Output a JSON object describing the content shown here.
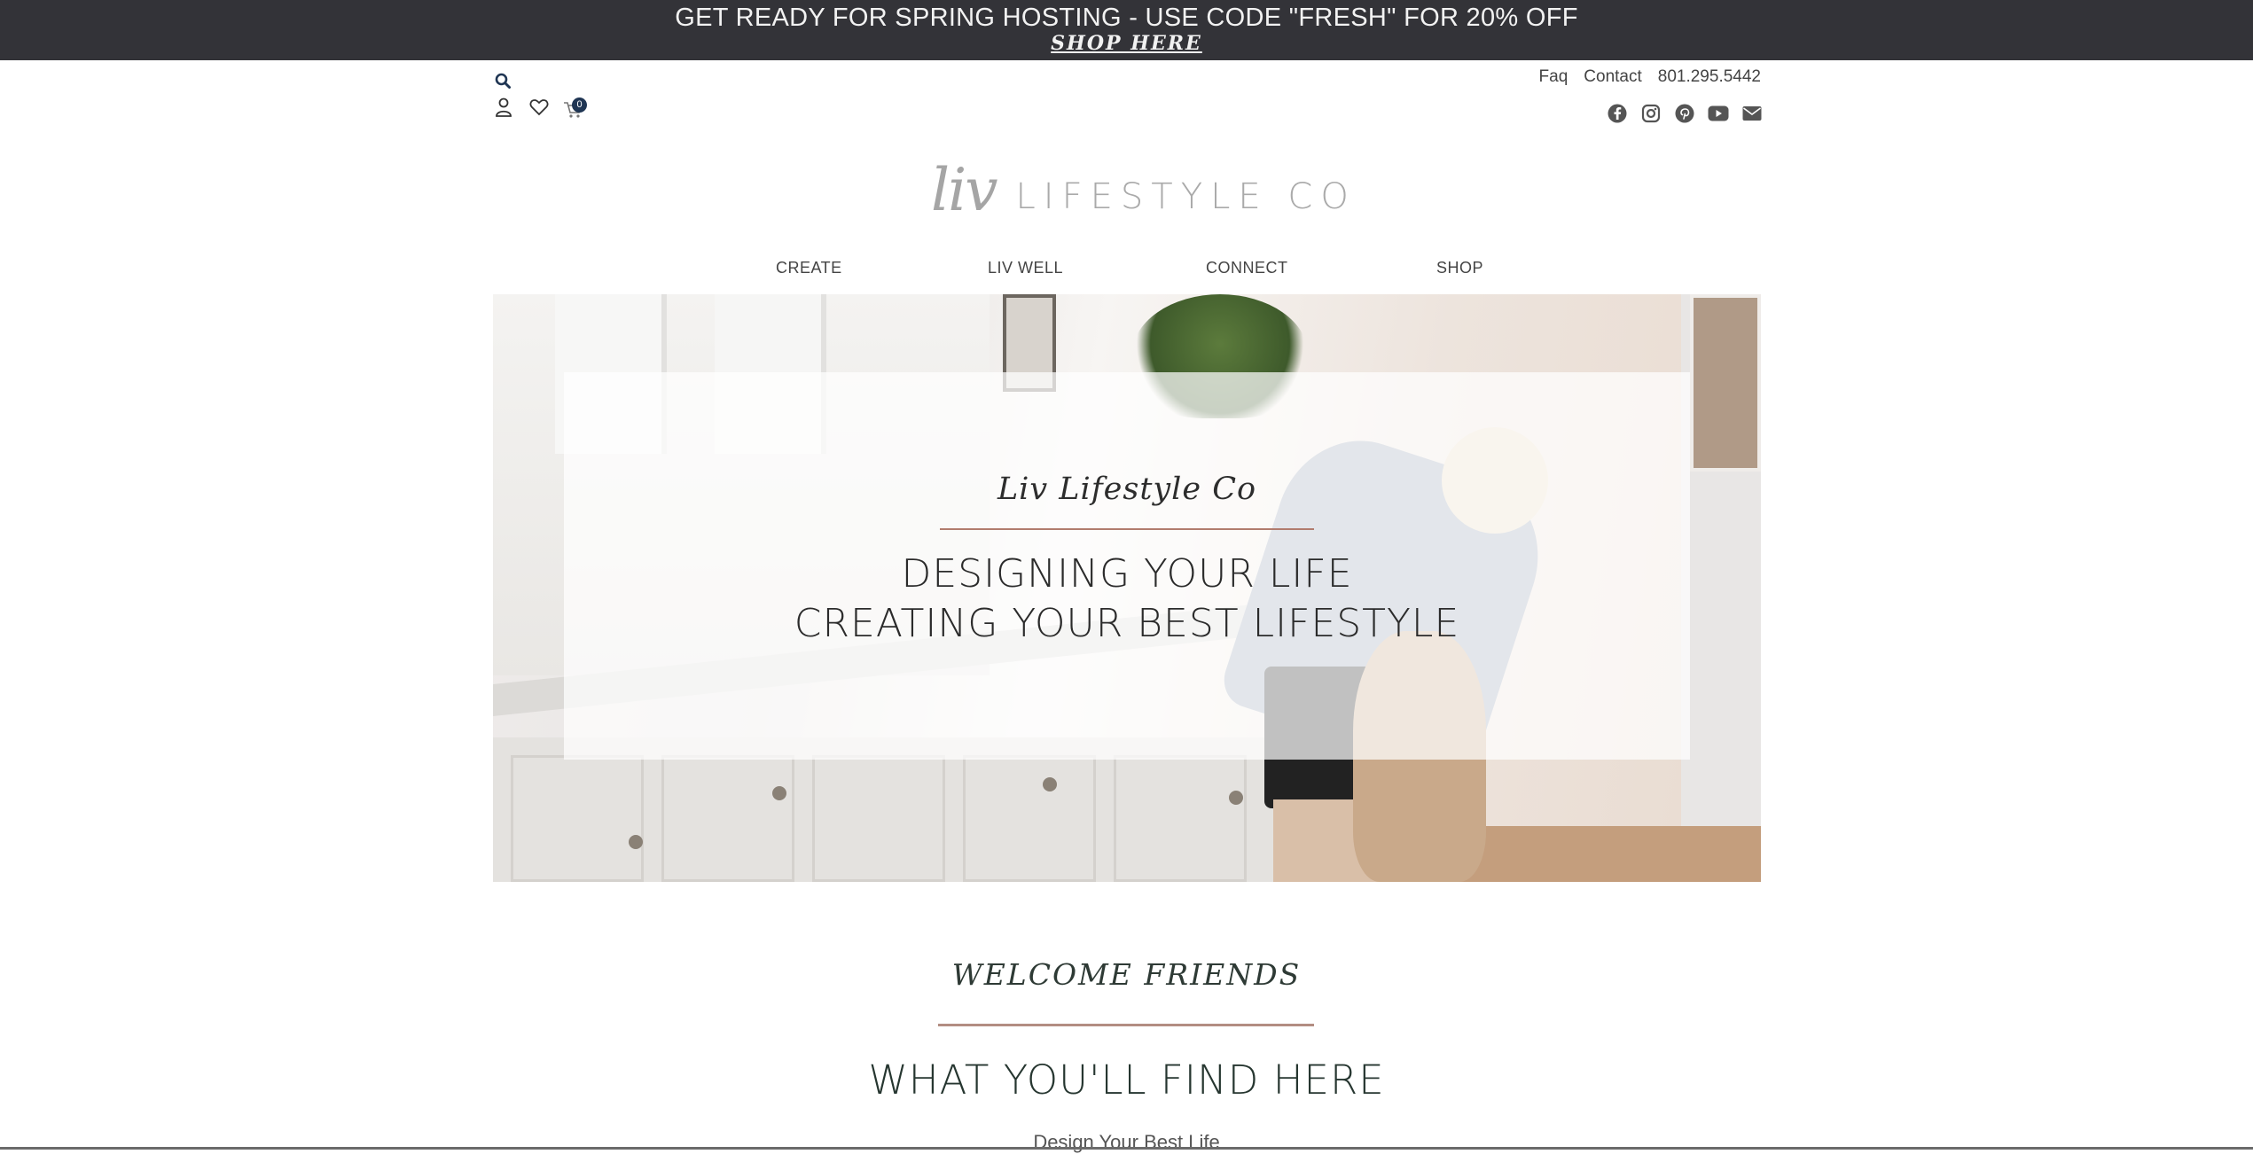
{
  "announcement": {
    "promo_text": "GET READY FOR SPRING HOSTING - USE CODE \"FRESH\" FOR 20% OFF",
    "link_text": "SHOP HERE"
  },
  "utility": {
    "cart_count": "0",
    "links": [
      "Faq",
      "Contact",
      "801.295.5442"
    ],
    "social_icons": [
      "facebook-icon",
      "instagram-icon",
      "pinterest-icon",
      "youtube-icon",
      "email-icon"
    ]
  },
  "logo": {
    "script": "liv",
    "word": "LIFESTYLE CO"
  },
  "nav": [
    "CREATE",
    "LIV WELL",
    "CONNECT",
    "SHOP"
  ],
  "hero": {
    "script_title": "Liv Lifestyle Co",
    "line1": "DESIGNING YOUR LIFE",
    "line2": "CREATING YOUR BEST LIFESTYLE"
  },
  "section": {
    "welcome": "WELCOME FRIENDS",
    "heading": "WHAT YOU'LL FIND HERE",
    "subheading": "Design Your Best Life"
  },
  "colors": {
    "topbar": "#333338",
    "accent_rule": "#b17c6e",
    "badge": "#1f3553"
  }
}
